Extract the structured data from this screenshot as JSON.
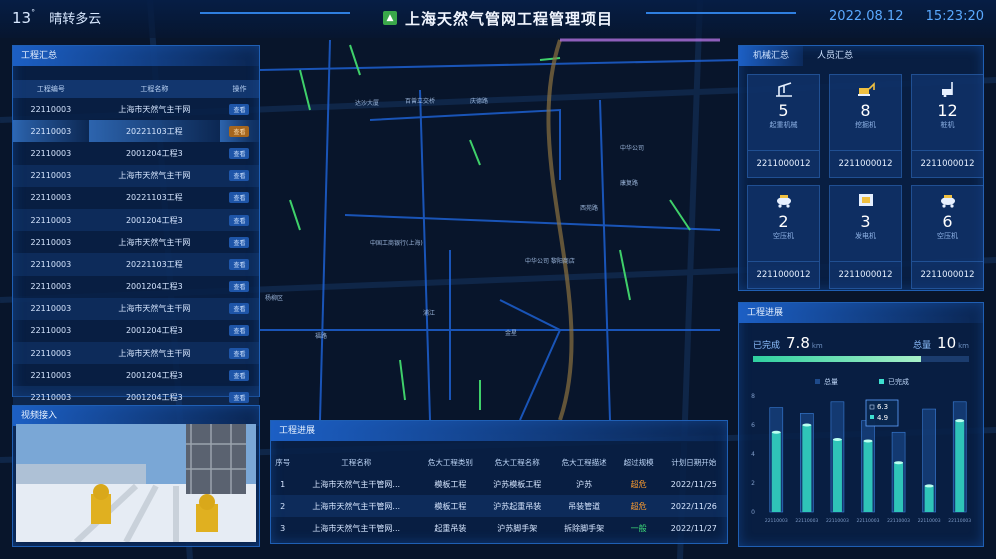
{
  "header": {
    "temperature": "13",
    "degree_mark": "°",
    "weather": "晴转多云",
    "title": "上海天然气管网工程管理项目",
    "date": "2022.08.12",
    "time": "15:23:20"
  },
  "map_labels": [
    "百曾立交桥",
    "庆德路",
    "中国工商银行(上海)",
    "中华公司 黎阳商店",
    "康复路",
    "西苑路",
    "浦江",
    "金星",
    "福路",
    "达沙大厦",
    "中华公司",
    "杨柳区"
  ],
  "summary": {
    "title": "工程汇总",
    "columns": [
      "工程编号",
      "工程名称",
      "操作"
    ],
    "rows": [
      {
        "id": "22110003",
        "name": "上海市天然气主干网",
        "action": "查看"
      },
      {
        "id": "22110003",
        "name": "20221103工程",
        "action": "查看"
      },
      {
        "id": "22110003",
        "name": "2001204工程3",
        "action": "查看"
      },
      {
        "id": "22110003",
        "name": "上海市天然气主干网",
        "action": "查看"
      },
      {
        "id": "22110003",
        "name": "20221103工程",
        "action": "查看"
      },
      {
        "id": "22110003",
        "name": "2001204工程3",
        "action": "查看"
      },
      {
        "id": "22110003",
        "name": "上海市天然气主干网",
        "action": "查看"
      },
      {
        "id": "22110003",
        "name": "20221103工程",
        "action": "查看"
      },
      {
        "id": "22110003",
        "name": "2001204工程3",
        "action": "查看"
      },
      {
        "id": "22110003",
        "name": "上海市天然气主干网",
        "action": "查看"
      },
      {
        "id": "22110003",
        "name": "2001204工程3",
        "action": "查看"
      },
      {
        "id": "22110003",
        "name": "上海市天然气主干网",
        "action": "查看"
      },
      {
        "id": "22110003",
        "name": "2001204工程3",
        "action": "查看"
      },
      {
        "id": "22110003",
        "name": "2001204工程3",
        "action": "查看"
      }
    ]
  },
  "video": {
    "title": "视频接入"
  },
  "machines": {
    "tabs": [
      "机械汇总",
      "人员汇总"
    ],
    "items": [
      {
        "count": "5",
        "label": "起重机械",
        "code": "2211000012",
        "icon": "crane-icon"
      },
      {
        "count": "8",
        "label": "挖掘机",
        "code": "2211000012",
        "icon": "excavator-icon"
      },
      {
        "count": "12",
        "label": "桩机",
        "code": "2211000012",
        "icon": "pile-driver-icon"
      },
      {
        "count": "2",
        "label": "空压机",
        "code": "2211000012",
        "icon": "compressor-icon"
      },
      {
        "count": "3",
        "label": "发电机",
        "code": "2211000012",
        "icon": "generator-icon"
      },
      {
        "count": "6",
        "label": "空压机",
        "code": "2211000012",
        "icon": "compressor-icon"
      }
    ]
  },
  "progress": {
    "title": "工程进展",
    "done_label": "已完成",
    "done_value": "7.8",
    "done_unit": "km",
    "total_label": "总量",
    "total_value": "10",
    "total_unit": "km",
    "ratio": 0.78
  },
  "chart_data": {
    "type": "bar",
    "legend": [
      "总量",
      "已完成"
    ],
    "categories": [
      "22110003",
      "22110003",
      "22110003",
      "22110003",
      "22110003",
      "22110003",
      "22110003"
    ],
    "series": [
      {
        "name": "总量",
        "values": [
          7.2,
          6.8,
          7.6,
          6.3,
          5.5,
          7.1,
          7.6
        ]
      },
      {
        "name": "已完成",
        "values": [
          5.5,
          6.0,
          5.0,
          4.9,
          3.4,
          1.8,
          6.3
        ]
      }
    ],
    "ylim": [
      0,
      8
    ],
    "yticks": [
      "0",
      "2",
      "4",
      "6",
      "8"
    ],
    "tooltip": {
      "total": "6.3",
      "done": "4.9"
    }
  },
  "projects": {
    "title": "工程进展",
    "columns": [
      "序号",
      "工程名称",
      "危大工程类别",
      "危大工程名称",
      "危大工程描述",
      "超过规模",
      "计划日期开始"
    ],
    "rows": [
      {
        "no": "1",
        "name": "上海市天然气主干管网...",
        "category": "模板工程",
        "hazard": "沪苏模板工程",
        "desc": "沪苏",
        "scale": "超危",
        "date": "2022/11/25",
        "scale_color": "#ff9d2e"
      },
      {
        "no": "2",
        "name": "上海市天然气主干管网...",
        "category": "模板工程",
        "hazard": "沪苏起重吊装",
        "desc": "吊装管道",
        "scale": "超危",
        "date": "2022/11/26",
        "scale_color": "#ff9d2e"
      },
      {
        "no": "3",
        "name": "上海市天然气主干管网...",
        "category": "起重吊装",
        "hazard": "沪苏脚手架",
        "desc": "拆除脚手架",
        "scale": "一般",
        "date": "2022/11/27",
        "scale_color": "#3ee07a"
      }
    ]
  }
}
